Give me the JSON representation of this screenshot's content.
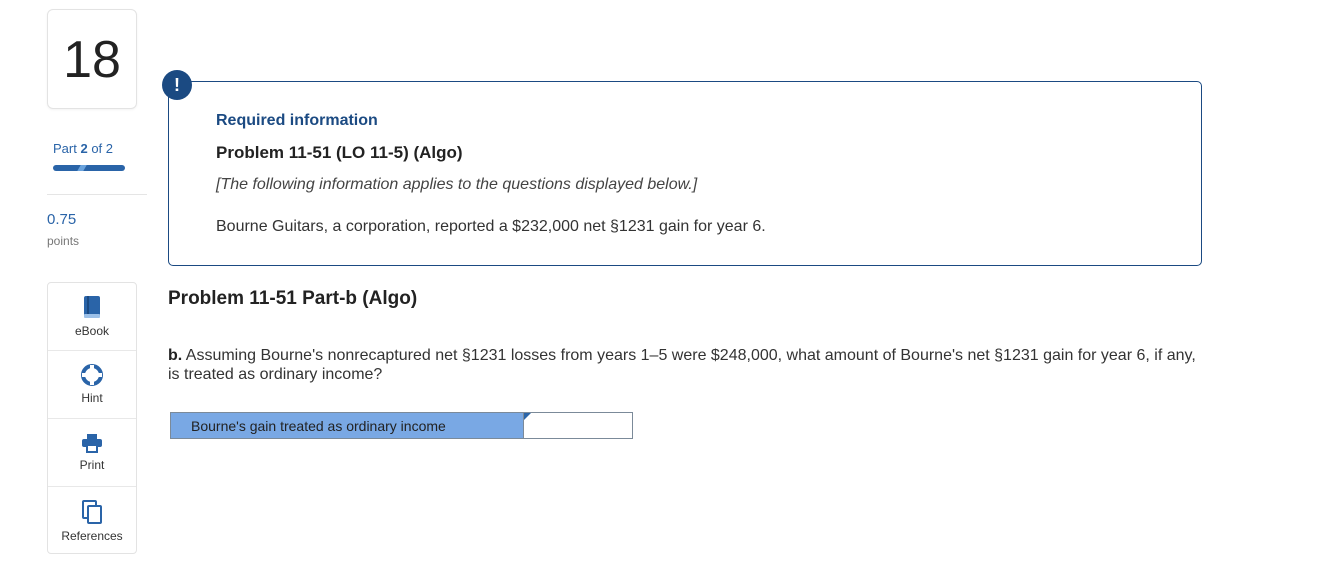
{
  "question_number": "18",
  "part": {
    "prefix": "Part",
    "current": "2",
    "suffix": "of 2",
    "progress": 1.0
  },
  "points": {
    "value": "0.75",
    "label": "points"
  },
  "tools": [
    {
      "label": "eBook",
      "icon": "book-icon"
    },
    {
      "label": "Hint",
      "icon": "lifebuoy-icon"
    },
    {
      "label": "Print",
      "icon": "printer-icon"
    },
    {
      "label": "References",
      "icon": "copy-icon"
    }
  ],
  "info": {
    "badge": "!",
    "required": "Required information",
    "title": "Problem 11-51 (LO 11-5) (Algo)",
    "note": "[The following information applies to the questions displayed below.]",
    "text": "Bourne Guitars, a corporation, reported a $232,000 net §1231 gain for year 6."
  },
  "part_heading": "Problem 11-51 Part-b (Algo)",
  "question": {
    "label": "b.",
    "text": "Assuming Bourne's nonrecaptured net §1231 losses from years 1–5 were $248,000, what amount of Bourne's net §1231 gain for year 6, if any, is treated as ordinary income?"
  },
  "answer": {
    "label": "Bourne's gain treated as ordinary income",
    "value": ""
  },
  "colors": {
    "accent": "#1b4a82",
    "link": "#2a64a8",
    "answer_label_bg": "#79a8e4"
  }
}
